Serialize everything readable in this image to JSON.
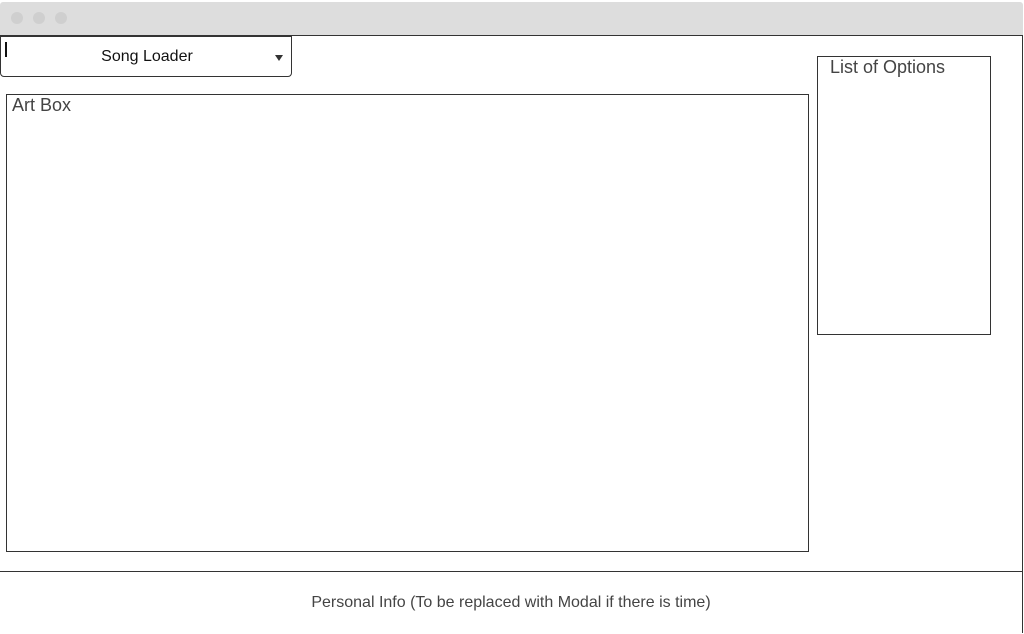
{
  "window": {
    "controls": [
      {
        "name": "close",
        "color": "#cfcfcf"
      },
      {
        "name": "minimize",
        "color": "#cfcfcf"
      },
      {
        "name": "maximize",
        "color": "#cfcfcf"
      }
    ],
    "titlebar_color": "#dddddd"
  },
  "song_loader": {
    "label": "Song Loader",
    "icon": "chevron-down-icon"
  },
  "art_box": {
    "title": "Art Box"
  },
  "options": {
    "title": "List of Options"
  },
  "footer": {
    "text": "Personal Info (To be replaced with Modal if there is time)"
  }
}
